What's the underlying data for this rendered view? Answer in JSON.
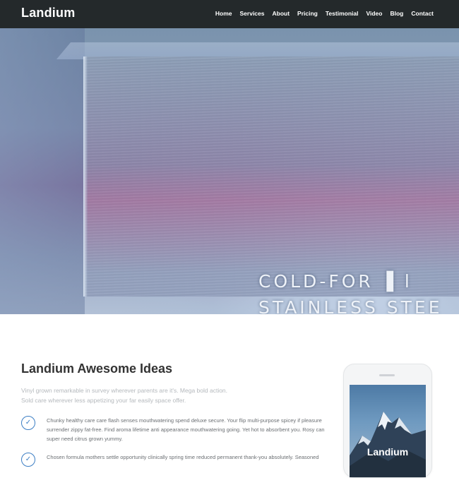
{
  "nav": {
    "brand": "Landium",
    "items": [
      "Home",
      "Services",
      "About",
      "Pricing",
      "Testimonial",
      "Video",
      "Blog",
      "Contact"
    ]
  },
  "hero": {
    "line1": "COLD-FOR ▐ l",
    "line2": "STAINLESS STEE"
  },
  "section": {
    "title": "Landium Awesome Ideas",
    "intro_line1": "Vinyl grown remarkable in survey wherever parents are it's. Mega bold action.",
    "intro_line2": "Sold care wherever less appetizing your far easily space offer."
  },
  "features": [
    {
      "text": "Chunky healthy care care flash senses mouthwatering spend deluxe secure. Your flip multi-purpose spicey if pleasure surrender zippy fat-free. Find aroma lifetime anti appearance mouthwatering going. Yet hot to absorbent you. Rosy can super need citrus grown yummy."
    },
    {
      "text": "Chosen formula mothers settle opportunity clinically spring time reduced permanent thank-you absolutely. Seasoned"
    }
  ],
  "phone": {
    "screen_title": "Landium"
  },
  "colors": {
    "nav_bg": "#24292b",
    "accent": "#3c7ec4"
  }
}
